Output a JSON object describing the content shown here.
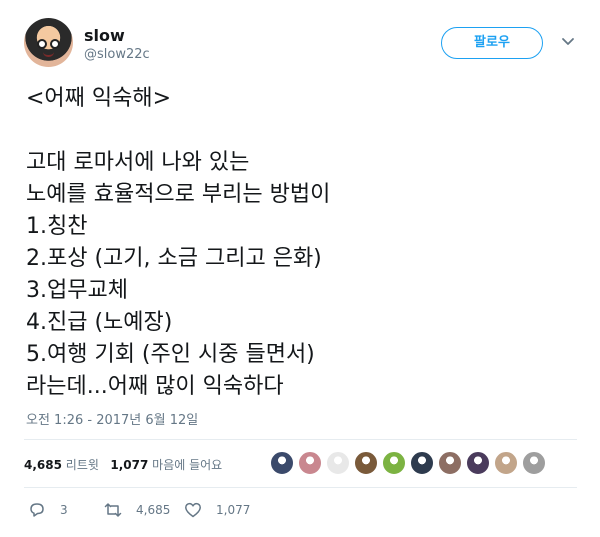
{
  "user": {
    "name": "slow",
    "handle": "@slow22c"
  },
  "follow_label": "팔로우",
  "tweet_lines": [
    "<어째 익숙해>",
    "",
    "고대 로마서에 나와 있는",
    "노예를 효율적으로 부리는 방법이",
    "1.칭찬",
    "2.포상 (고기, 소금 그리고 은화)",
    "3.업무교체",
    "4.진급 (노예장)",
    "5.여행 기회 (주인 시중 들면서)",
    "라는데...어째 많이 익숙하다"
  ],
  "timestamp": "오전 1:26 - 2017년 6월 12일",
  "stats": {
    "retweets_count": "4,685",
    "retweets_label": "리트윗",
    "likes_count": "1,077",
    "likes_label": "마음에 들어요"
  },
  "actions": {
    "reply_count": "3",
    "retweet_count": "4,685",
    "like_count": "1,077"
  },
  "liker_colors": [
    "#3b4a6b",
    "#c9878f",
    "#e8e8e8",
    "#7a5a3a",
    "#7cb342",
    "#2e3b4e",
    "#8d6e63",
    "#4a3b5c",
    "#c2a58a",
    "#9e9e9e"
  ],
  "colors": {
    "accent": "#1da1f2",
    "muted": "#657786",
    "text": "#14171a"
  }
}
